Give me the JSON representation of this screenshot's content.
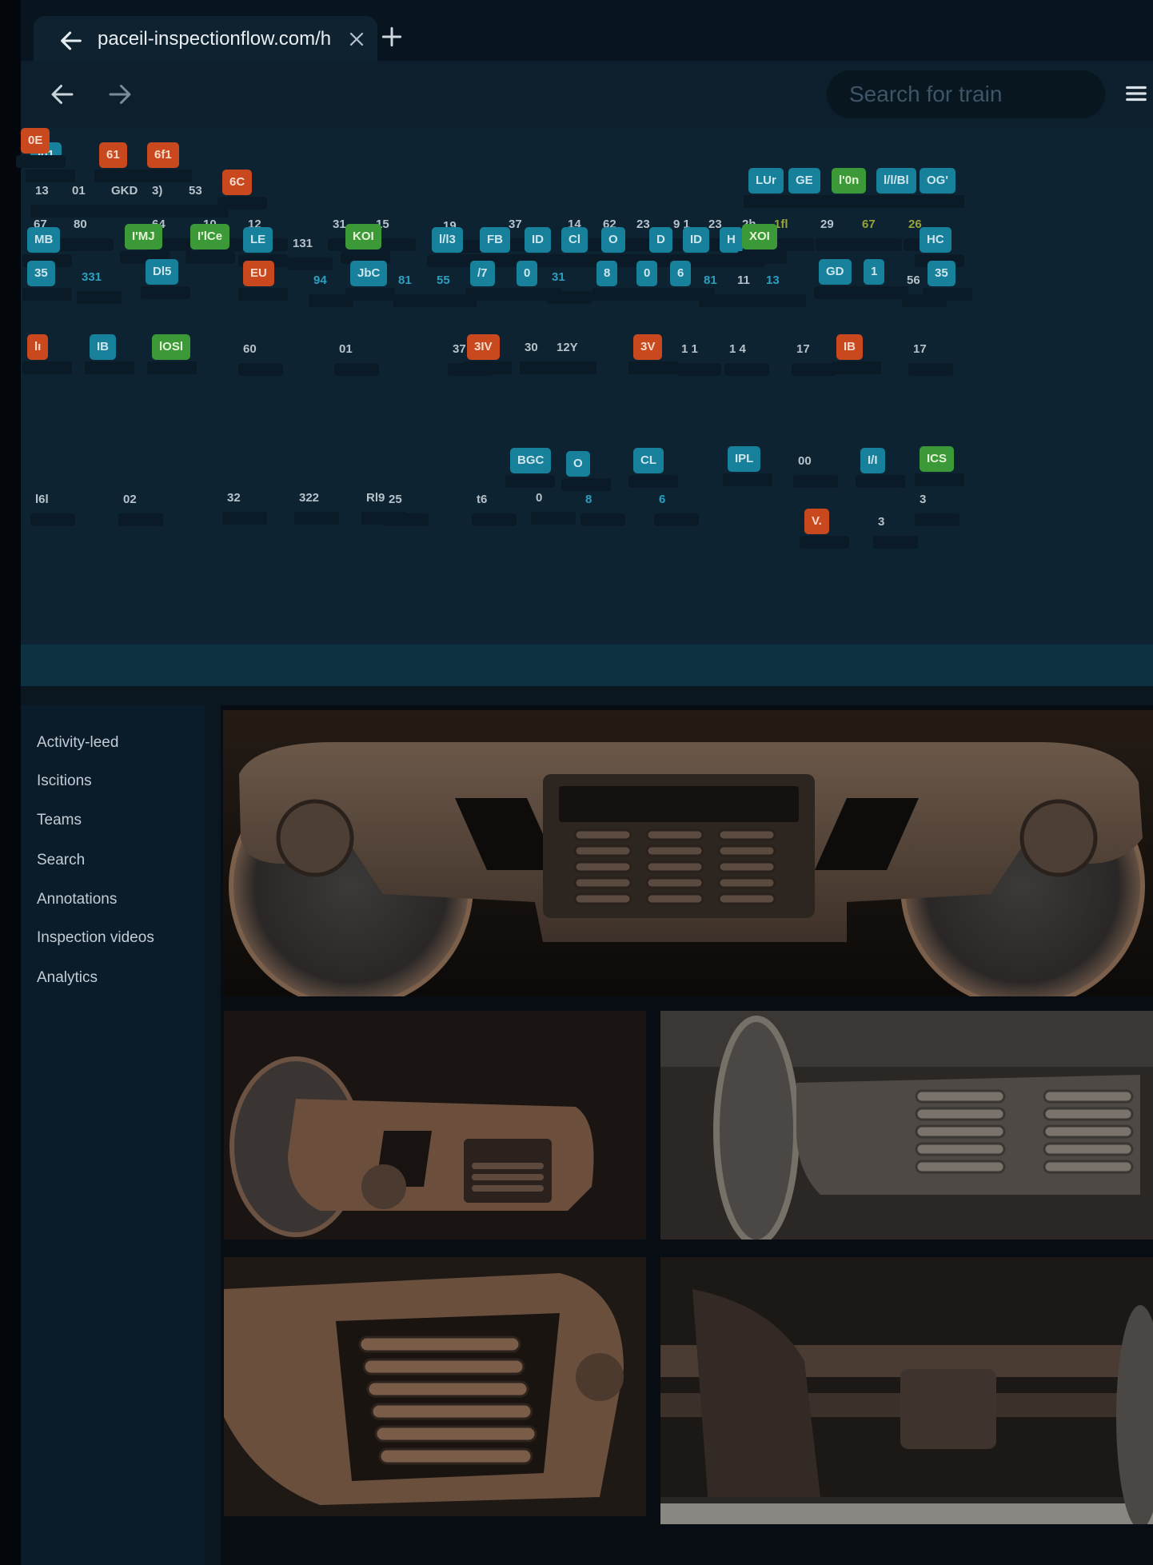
{
  "tab": {
    "url": "paceil-inspectionflow.com/h"
  },
  "toolbar": {
    "search_placeholder": "Search for train"
  },
  "board_items": [
    {
      "text": "l01",
      "kind": "chip",
      "color": "teal"
    },
    {
      "text": "61",
      "kind": "chip",
      "color": "red"
    },
    {
      "text": "6f1",
      "kind": "chip",
      "color": "red"
    },
    {
      "text": "13",
      "kind": "num",
      "color": "gray"
    },
    {
      "text": "01",
      "kind": "num",
      "color": "gray"
    },
    {
      "text": "GKD",
      "kind": "num",
      "color": "gray"
    },
    {
      "text": "3)",
      "kind": "num",
      "color": "gray"
    },
    {
      "text": "53",
      "kind": "num",
      "color": "gray"
    },
    {
      "text": "6C",
      "kind": "chip",
      "color": "red"
    },
    {
      "text": "LUr",
      "kind": "chip",
      "color": "teal"
    },
    {
      "text": "GE",
      "kind": "chip",
      "color": "teal"
    },
    {
      "text": "l'0n",
      "kind": "chip",
      "color": "green"
    },
    {
      "text": "l/l/Bl",
      "kind": "chip",
      "color": "teal"
    },
    {
      "text": "OG'",
      "kind": "chip",
      "color": "teal"
    },
    {
      "text": "67",
      "kind": "num",
      "color": "gray"
    },
    {
      "text": "80",
      "kind": "num",
      "color": "gray"
    },
    {
      "text": "64",
      "kind": "num",
      "color": "gray"
    },
    {
      "text": "10",
      "kind": "num",
      "color": "gray"
    },
    {
      "text": "12",
      "kind": "num",
      "color": "gray"
    },
    {
      "text": "31",
      "kind": "num",
      "color": "gray"
    },
    {
      "text": "15",
      "kind": "num",
      "color": "gray"
    },
    {
      "text": "19",
      "kind": "num",
      "color": "gray"
    },
    {
      "text": "37",
      "kind": "num",
      "color": "gray"
    },
    {
      "text": "14",
      "kind": "num",
      "color": "gray"
    },
    {
      "text": "62",
      "kind": "num",
      "color": "gray"
    },
    {
      "text": "23",
      "kind": "num",
      "color": "gray"
    },
    {
      "text": "9 1",
      "kind": "num",
      "color": "gray"
    },
    {
      "text": "23",
      "kind": "num",
      "color": "gray"
    },
    {
      "text": "2h",
      "kind": "num",
      "color": "gray"
    },
    {
      "text": "1fl",
      "kind": "num",
      "color": "olive"
    },
    {
      "text": "29",
      "kind": "num",
      "color": "gray"
    },
    {
      "text": "67",
      "kind": "num",
      "color": "olive"
    },
    {
      "text": "26",
      "kind": "num",
      "color": "olive"
    },
    {
      "text": "MB",
      "kind": "chip",
      "color": "teal"
    },
    {
      "text": "I'MJ",
      "kind": "chip",
      "color": "green"
    },
    {
      "text": "I'lCe",
      "kind": "chip",
      "color": "green"
    },
    {
      "text": "LE",
      "kind": "chip",
      "color": "teal"
    },
    {
      "text": "131",
      "kind": "num",
      "color": "gray"
    },
    {
      "text": "KOI",
      "kind": "chip",
      "color": "green"
    },
    {
      "text": "l/l3",
      "kind": "chip",
      "color": "teal"
    },
    {
      "text": "FB",
      "kind": "chip",
      "color": "teal"
    },
    {
      "text": "ID",
      "kind": "chip",
      "color": "teal"
    },
    {
      "text": "Cl",
      "kind": "chip",
      "color": "teal"
    },
    {
      "text": "O",
      "kind": "chip",
      "color": "teal"
    },
    {
      "text": "D",
      "kind": "chip",
      "color": "teal"
    },
    {
      "text": "ID",
      "kind": "chip",
      "color": "teal"
    },
    {
      "text": "H",
      "kind": "chip",
      "color": "teal"
    },
    {
      "text": "XOI",
      "kind": "chip",
      "color": "green"
    },
    {
      "text": "HC",
      "kind": "chip",
      "color": "teal"
    },
    {
      "text": "35",
      "kind": "chip",
      "color": "teal"
    },
    {
      "text": "331",
      "kind": "num",
      "color": "teal"
    },
    {
      "text": "Dl5",
      "kind": "chip",
      "color": "teal"
    },
    {
      "text": "EU",
      "kind": "chip",
      "color": "red"
    },
    {
      "text": "94",
      "kind": "num",
      "color": "teal"
    },
    {
      "text": "JbC",
      "kind": "chip",
      "color": "teal"
    },
    {
      "text": "81",
      "kind": "num",
      "color": "teal"
    },
    {
      "text": "55",
      "kind": "num",
      "color": "teal"
    },
    {
      "text": "/7",
      "kind": "chip",
      "color": "teal"
    },
    {
      "text": "0",
      "kind": "chip",
      "color": "teal"
    },
    {
      "text": "31",
      "kind": "num",
      "color": "teal"
    },
    {
      "text": "8",
      "kind": "chip",
      "color": "teal"
    },
    {
      "text": "0",
      "kind": "chip",
      "color": "teal"
    },
    {
      "text": "6",
      "kind": "chip",
      "color": "teal"
    },
    {
      "text": "81",
      "kind": "num",
      "color": "teal"
    },
    {
      "text": "11",
      "kind": "num",
      "color": "gray"
    },
    {
      "text": "13",
      "kind": "num",
      "color": "teal"
    },
    {
      "text": "GD",
      "kind": "chip",
      "color": "teal"
    },
    {
      "text": "1",
      "kind": "chip",
      "color": "teal"
    },
    {
      "text": "56",
      "kind": "num",
      "color": "gray"
    },
    {
      "text": "35",
      "kind": "chip",
      "color": "teal"
    },
    {
      "text": "lı",
      "kind": "chip",
      "color": "red"
    },
    {
      "text": "IB",
      "kind": "chip",
      "color": "teal"
    },
    {
      "text": "lOSl",
      "kind": "chip",
      "color": "green"
    },
    {
      "text": "60",
      "kind": "num",
      "color": "gray"
    },
    {
      "text": "01",
      "kind": "num",
      "color": "gray"
    },
    {
      "text": "37",
      "kind": "num",
      "color": "gray"
    },
    {
      "text": "3IV",
      "kind": "chip",
      "color": "red"
    },
    {
      "text": "30",
      "kind": "num",
      "color": "gray"
    },
    {
      "text": "12Y",
      "kind": "num",
      "color": "gray"
    },
    {
      "text": "3V",
      "kind": "chip",
      "color": "red"
    },
    {
      "text": "1 1",
      "kind": "num",
      "color": "gray"
    },
    {
      "text": "1 4",
      "kind": "num",
      "color": "gray"
    },
    {
      "text": "17",
      "kind": "num",
      "color": "gray"
    },
    {
      "text": "IB",
      "kind": "chip",
      "color": "red"
    },
    {
      "text": "17",
      "kind": "num",
      "color": "gray"
    },
    {
      "text": "BGC",
      "kind": "chip",
      "color": "teal"
    },
    {
      "text": "O",
      "kind": "chip",
      "color": "teal"
    },
    {
      "text": "CL",
      "kind": "chip",
      "color": "teal"
    },
    {
      "text": "IPL",
      "kind": "chip",
      "color": "teal"
    },
    {
      "text": "00",
      "kind": "num",
      "color": "gray"
    },
    {
      "text": "I/I",
      "kind": "chip",
      "color": "teal"
    },
    {
      "text": "ICS",
      "kind": "chip",
      "color": "green"
    },
    {
      "text": "l6l",
      "kind": "num",
      "color": "gray"
    },
    {
      "text": "02",
      "kind": "num",
      "color": "gray"
    },
    {
      "text": "32",
      "kind": "num",
      "color": "gray"
    },
    {
      "text": "322",
      "kind": "num",
      "color": "gray"
    },
    {
      "text": "Rl9",
      "kind": "num",
      "color": "gray"
    },
    {
      "text": "25",
      "kind": "num",
      "color": "gray"
    },
    {
      "text": "t6",
      "kind": "num",
      "color": "gray"
    },
    {
      "text": "0",
      "kind": "num",
      "color": "gray"
    },
    {
      "text": "8",
      "kind": "num",
      "color": "teal"
    },
    {
      "text": "6",
      "kind": "num",
      "color": "teal"
    },
    {
      "text": "V.",
      "kind": "chip",
      "color": "red"
    },
    {
      "text": "3",
      "kind": "num",
      "color": "gray"
    },
    {
      "text": "3",
      "kind": "num",
      "color": "gray"
    },
    {
      "text": "0E",
      "kind": "chip",
      "color": "red"
    }
  ],
  "sidebar": {
    "items": [
      {
        "label": "Activity-leed"
      },
      {
        "label": "Iscitions"
      },
      {
        "label": "Teams"
      },
      {
        "label": "Search"
      },
      {
        "label": "Annotations"
      },
      {
        "label": "Inspection videos"
      },
      {
        "label": "Analytics"
      }
    ]
  },
  "photos": [
    {
      "subject": "bogie-side-frame-wheels-springs"
    },
    {
      "subject": "bogie-angled-view"
    },
    {
      "subject": "wheelset-spring-closeup"
    },
    {
      "subject": "coil-springs-closeup"
    },
    {
      "subject": "undercarriage-axle"
    }
  ],
  "colors": {
    "teal": "#17809a",
    "red": "#c9481e",
    "green": "#3b9a37",
    "board": "#0e2331"
  }
}
